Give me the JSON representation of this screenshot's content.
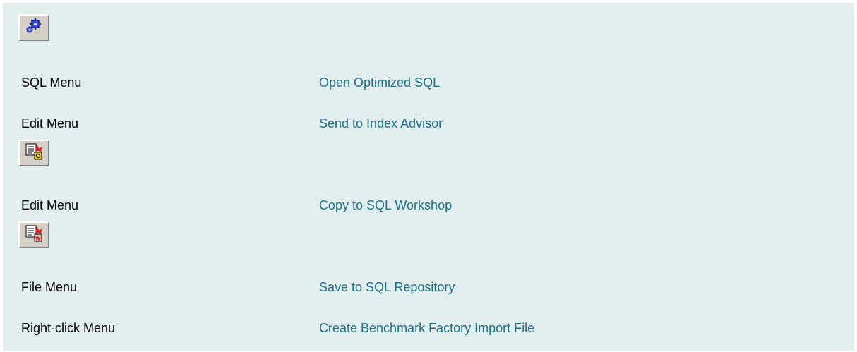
{
  "rows": [
    {
      "label": "SQL Menu",
      "link": "Open Optimized SQL"
    },
    {
      "label": "Edit Menu",
      "link": "Send to Index Advisor"
    },
    {
      "label": "Edit Menu",
      "link": "Copy to SQL Workshop"
    },
    {
      "label": "File Menu",
      "link": "Save to SQL Repository"
    },
    {
      "label": "Right-click Menu",
      "link": "Create Benchmark Factory Import File"
    }
  ],
  "icons": {
    "top": "gears-icon",
    "index_advisor": "send-to-index-advisor-icon",
    "workshop": "copy-to-workshop-icon"
  },
  "colors": {
    "panel_bg": "#e2eded",
    "link": "#1b6f86"
  }
}
